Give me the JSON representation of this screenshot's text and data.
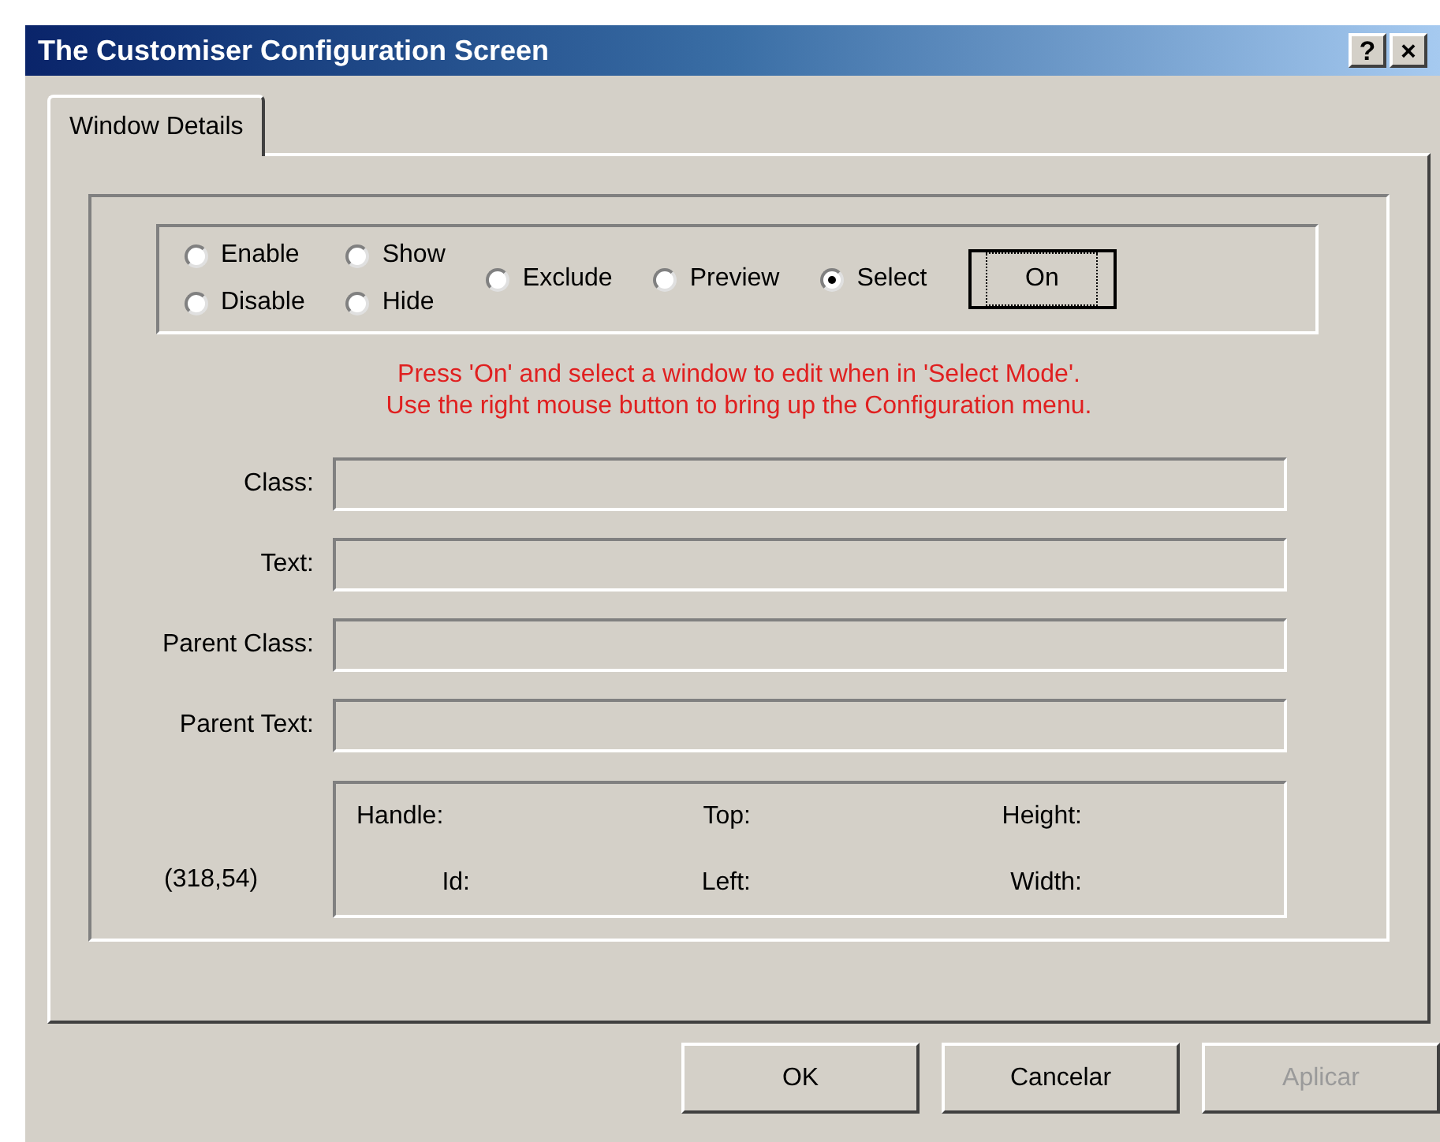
{
  "window": {
    "title": "The Customiser Configuration Screen",
    "title_buttons": [
      "?",
      "×"
    ]
  },
  "tabs": [
    {
      "label": "Window Details",
      "selected": true
    }
  ],
  "radio_groups": [
    {
      "options": [
        {
          "label": "Enable",
          "selected": false
        },
        {
          "label": "Disable",
          "selected": false
        }
      ]
    },
    {
      "options": [
        {
          "label": "Show",
          "selected": false
        },
        {
          "label": "Hide",
          "selected": false
        }
      ]
    },
    {
      "options": [
        {
          "label": "Exclude",
          "selected": false
        }
      ]
    },
    {
      "options": [
        {
          "label": "Preview",
          "selected": false
        }
      ]
    },
    {
      "options": [
        {
          "label": "Select",
          "selected": true
        }
      ]
    }
  ],
  "on_button": "On",
  "hint_lines": [
    "Press 'On' and select a window to edit when in 'Select Mode'.",
    "Use the right mouse button to bring up the Configuration menu."
  ],
  "fields": [
    {
      "label": "Class:"
    },
    {
      "label": "Text:"
    },
    {
      "label": "Parent Class:"
    },
    {
      "label": "Parent Text:"
    }
  ],
  "position": "(318,54)",
  "info_rows": [
    [
      "Handle:",
      "Top:",
      "Height:"
    ],
    [
      "Id:",
      "Left:",
      "Width:"
    ]
  ],
  "buttons": [
    {
      "label": "OK",
      "disabled": false
    },
    {
      "label": "Cancelar",
      "disabled": false
    },
    {
      "label": "Aplicar",
      "disabled": true
    }
  ]
}
